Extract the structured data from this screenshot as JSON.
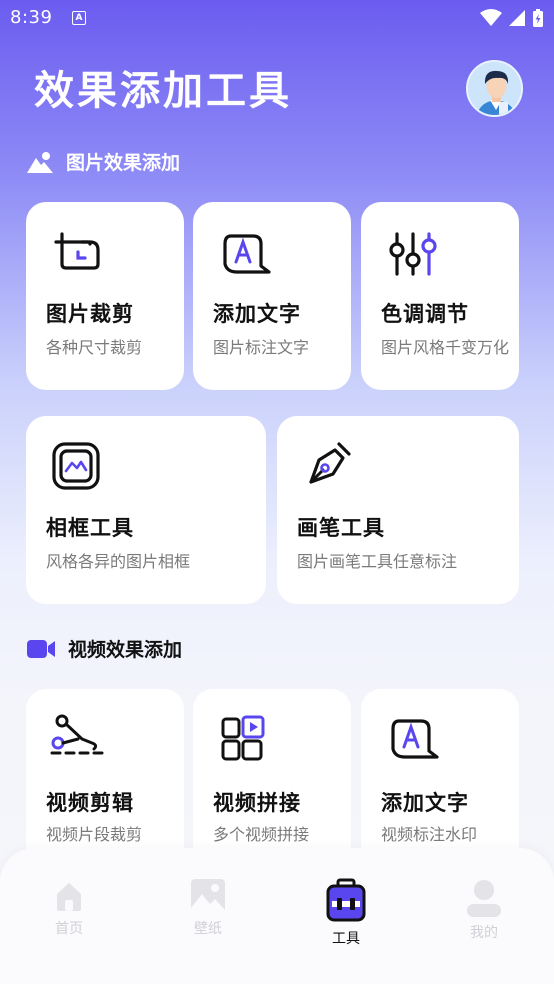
{
  "status": {
    "time": "8:39",
    "badge": "A"
  },
  "header": {
    "title": "效果添加工具"
  },
  "image_section": {
    "title": "图片效果添加",
    "cards": [
      {
        "title": "图片裁剪",
        "subtitle": "各种尺寸裁剪",
        "icon": "crop-icon"
      },
      {
        "title": "添加文字",
        "subtitle": "图片标注文字",
        "icon": "text-bubble-icon"
      },
      {
        "title": "色调调节",
        "subtitle": "图片风格千变万化",
        "icon": "sliders-icon"
      },
      {
        "title": "相框工具",
        "subtitle": "风格各异的图片相框",
        "icon": "frame-icon"
      },
      {
        "title": "画笔工具",
        "subtitle": "图片画笔工具任意标注",
        "icon": "pen-nib-icon"
      }
    ]
  },
  "video_section": {
    "title": "视频效果添加",
    "cards": [
      {
        "title": "视频剪辑",
        "subtitle": "视频片段裁剪",
        "icon": "scissors-icon"
      },
      {
        "title": "视频拼接",
        "subtitle": "多个视频拼接",
        "icon": "grid-play-icon"
      },
      {
        "title": "添加文字",
        "subtitle": "视频标注水印",
        "icon": "text-bubble-icon"
      }
    ]
  },
  "bottom_nav": {
    "items": [
      {
        "label": "首页",
        "icon": "home-icon",
        "active": false
      },
      {
        "label": "壁纸",
        "icon": "image-icon",
        "active": false
      },
      {
        "label": "工具",
        "icon": "toolbox-icon",
        "active": true
      },
      {
        "label": "我的",
        "icon": "user-icon",
        "active": false
      }
    ]
  },
  "colors": {
    "accent": "#5a46ee",
    "header_gradient_top": "#6b5cf0",
    "card_bg": "#ffffff",
    "subtitle": "#7a7a7a"
  }
}
